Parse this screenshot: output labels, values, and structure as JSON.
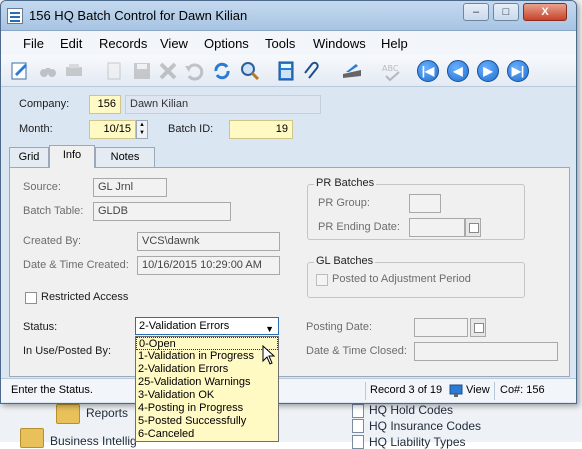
{
  "window": {
    "title": "156 HQ Batch Control for Dawn Kilian",
    "controls": [
      "–",
      "□",
      "X"
    ]
  },
  "menubar": {
    "items": [
      {
        "label": "File"
      },
      {
        "label": "Edit"
      },
      {
        "label": "Records"
      },
      {
        "label": "View"
      },
      {
        "label": "Options"
      },
      {
        "label": "Tools"
      },
      {
        "label": "Windows"
      },
      {
        "label": "Help"
      }
    ]
  },
  "toolbar": {
    "icons": [
      "new-record-icon",
      "binoculars-icon",
      "find-icon",
      "printer-icon",
      "document-icon",
      "save-icon",
      "delete-icon",
      "undo-icon",
      "refresh-icon",
      "search-icon",
      "calculator-icon",
      "attachment-icon",
      "scanner-icon",
      "spellcheck-icon"
    ],
    "nav": {
      "first": "|◀",
      "prev": "◀",
      "next": "▶",
      "last": "▶|"
    }
  },
  "header": {
    "company_label": "Company:",
    "company_value": "156",
    "company_name": "Dawn Kilian",
    "month_label": "Month:",
    "month_value": "10/15",
    "batch_label": "Batch ID:",
    "batch_value": "19"
  },
  "tabs": [
    {
      "label": "Grid"
    },
    {
      "label": "Info"
    },
    {
      "label": "Notes"
    }
  ],
  "info": {
    "source_label": "Source:",
    "source_value": "GL Jrnl",
    "batch_table_label": "Batch Table:",
    "batch_table_value": "GLDB",
    "created_by_label": "Created By:",
    "created_by_value": "VCS\\dawnk",
    "date_created_label": "Date & Time Created:",
    "date_created_value": "10/16/2015 10:29:00 AM",
    "restricted_label": "Restricted Access",
    "status_label": "Status:",
    "status_value": "2-Validation Errors",
    "in_use_label": "In Use/Posted By:",
    "pr_batches_title": "PR Batches",
    "pr_group_label": "PR Group:",
    "pr_ending_label": "PR Ending Date:",
    "gl_batches_title": "GL Batches",
    "posted_adj_label": "Posted to Adjustment Period",
    "posting_date_label": "Posting Date:",
    "date_closed_label": "Date & Time Closed:"
  },
  "status_options": [
    "0-Open",
    "1-Validation in Progress",
    "2-Validation Errors",
    "25-Validation Warnings",
    "3-Validation OK",
    "4-Posting in Progress",
    "5-Posted Successfully",
    "6-Canceled"
  ],
  "statusbar": {
    "message": "Enter the Status.",
    "record": "Record 3 of 19",
    "view": "View",
    "co": "Co#: 156"
  },
  "background": {
    "reports": "Reports",
    "business": "Business Intellig",
    "hq_hold": "HQ Hold Codes",
    "hq_insurance": "HQ Insurance Codes",
    "hq_liability": "HQ Liability Types"
  }
}
